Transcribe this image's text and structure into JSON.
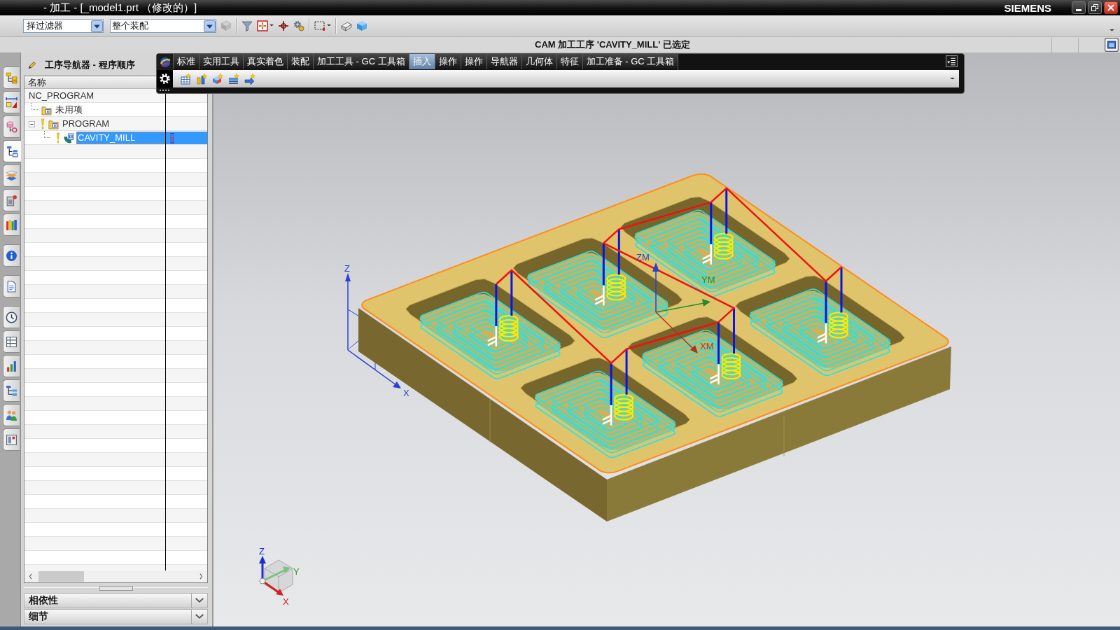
{
  "window": {
    "title": "- 加工 - [_model1.prt （修改的）]",
    "brand": "SIEMENS"
  },
  "selection_bar": {
    "filters": [
      {
        "value": "择过滤器"
      },
      {
        "value": "整个装配"
      }
    ]
  },
  "status_bar": {
    "message": "CAM 加工工序 'CAVITY_MILL' 已选定"
  },
  "resource_bar": {
    "groups": [
      {
        "tabs": [
          {
            "selected": false
          },
          {
            "selected": false
          },
          {
            "selected": false
          },
          {
            "selected": true
          },
          {
            "selected": false
          },
          {
            "selected": false
          },
          {
            "selected": false
          }
        ]
      },
      {
        "tabs": [
          {
            "selected": false
          }
        ]
      },
      {
        "tabs": [
          {
            "selected": false
          }
        ]
      },
      {
        "tabs": [
          {
            "selected": false
          },
          {
            "selected": false
          },
          {
            "selected": false
          },
          {
            "selected": false
          },
          {
            "selected": false
          },
          {
            "selected": false
          }
        ]
      }
    ]
  },
  "toolbar": {
    "tabs": [
      {
        "label": "标准",
        "selected": false
      },
      {
        "label": "实用工具",
        "selected": false
      },
      {
        "label": "真实着色",
        "selected": false
      },
      {
        "label": "装配",
        "selected": false
      },
      {
        "label": "加工工具 - GC 工具箱",
        "selected": false
      },
      {
        "label": "插入",
        "selected": true
      },
      {
        "label": "操作",
        "selected": false
      },
      {
        "label": "操作",
        "selected": false
      },
      {
        "label": "导航器",
        "selected": false
      },
      {
        "label": "几何体",
        "selected": false
      },
      {
        "label": "特征",
        "selected": false
      },
      {
        "label": "加工准备 - GC 工具箱",
        "selected": false
      }
    ]
  },
  "navigator": {
    "title": "工序导航器 - 程序顺序",
    "column": "名称",
    "tree": [
      {
        "name": "NC_PROGRAM",
        "selected": false,
        "needs_regeneration": false,
        "children": [
          {
            "name": "未用项",
            "kind": "group",
            "selected": false,
            "needs_regeneration": false
          },
          {
            "name": "PROGRAM",
            "kind": "group",
            "selected": false,
            "needs_regeneration": true,
            "expanded": true,
            "children": [
              {
                "name": "CAVITY_MILL",
                "kind": "operation",
                "selected": true,
                "needs_regeneration": true
              }
            ]
          }
        ]
      }
    ],
    "sections": [
      {
        "label": "相依性",
        "expanded": false
      },
      {
        "label": "细节",
        "expanded": false
      }
    ]
  },
  "viewport": {
    "wcs_axes": {
      "z": "Z",
      "x": "X"
    },
    "mcs_axes": {
      "z": "ZM",
      "y": "YM",
      "x": "XM"
    },
    "view_triad": {
      "z": "Z",
      "y": "Y",
      "x": "X"
    }
  }
}
